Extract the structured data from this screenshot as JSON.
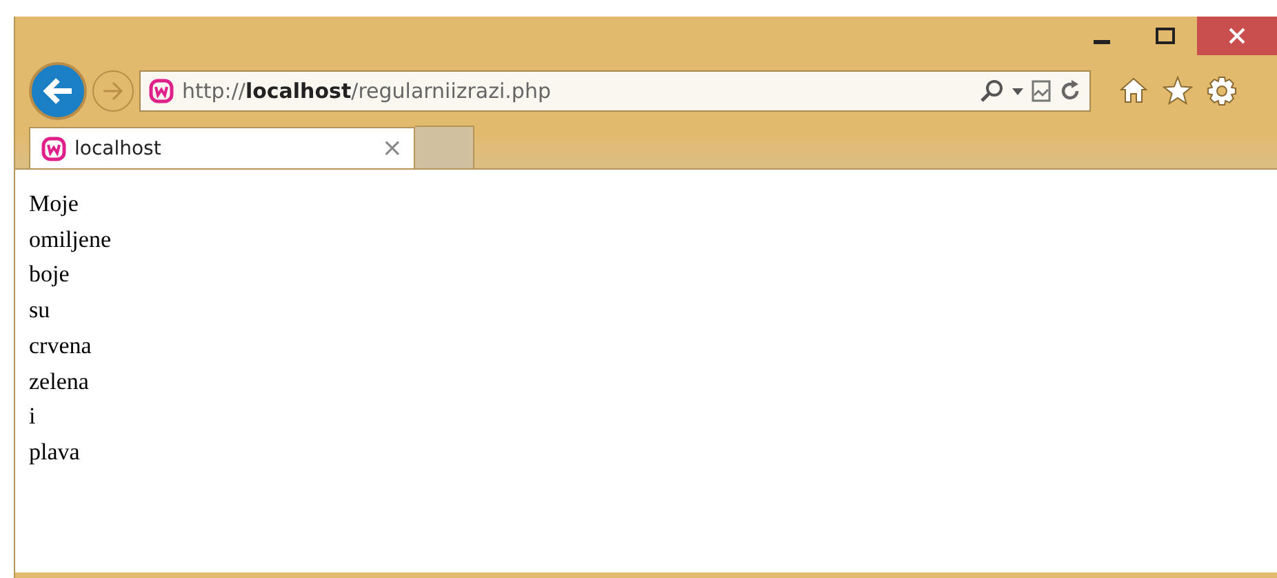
{
  "address_bar": {
    "url": "http://**localhost**/regularniizrazi.php"
  },
  "tabs": [
    {
      "label": "localhost",
      "close": "×",
      "selected": true
    }
  ],
  "content": {
    "lines": [
      "Moje",
      "omiljene",
      "boje",
      "su",
      "crvena",
      "zelena",
      "i",
      "plava"
    ]
  }
}
